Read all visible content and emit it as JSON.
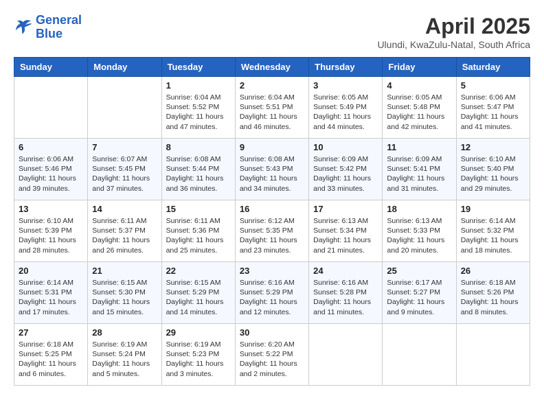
{
  "header": {
    "logo_line1": "General",
    "logo_line2": "Blue",
    "month_title": "April 2025",
    "location": "Ulundi, KwaZulu-Natal, South Africa"
  },
  "days_of_week": [
    "Sunday",
    "Monday",
    "Tuesday",
    "Wednesday",
    "Thursday",
    "Friday",
    "Saturday"
  ],
  "weeks": [
    [
      {
        "day": "",
        "info": ""
      },
      {
        "day": "",
        "info": ""
      },
      {
        "day": "1",
        "info": "Sunrise: 6:04 AM\nSunset: 5:52 PM\nDaylight: 11 hours and 47 minutes."
      },
      {
        "day": "2",
        "info": "Sunrise: 6:04 AM\nSunset: 5:51 PM\nDaylight: 11 hours and 46 minutes."
      },
      {
        "day": "3",
        "info": "Sunrise: 6:05 AM\nSunset: 5:49 PM\nDaylight: 11 hours and 44 minutes."
      },
      {
        "day": "4",
        "info": "Sunrise: 6:05 AM\nSunset: 5:48 PM\nDaylight: 11 hours and 42 minutes."
      },
      {
        "day": "5",
        "info": "Sunrise: 6:06 AM\nSunset: 5:47 PM\nDaylight: 11 hours and 41 minutes."
      }
    ],
    [
      {
        "day": "6",
        "info": "Sunrise: 6:06 AM\nSunset: 5:46 PM\nDaylight: 11 hours and 39 minutes."
      },
      {
        "day": "7",
        "info": "Sunrise: 6:07 AM\nSunset: 5:45 PM\nDaylight: 11 hours and 37 minutes."
      },
      {
        "day": "8",
        "info": "Sunrise: 6:08 AM\nSunset: 5:44 PM\nDaylight: 11 hours and 36 minutes."
      },
      {
        "day": "9",
        "info": "Sunrise: 6:08 AM\nSunset: 5:43 PM\nDaylight: 11 hours and 34 minutes."
      },
      {
        "day": "10",
        "info": "Sunrise: 6:09 AM\nSunset: 5:42 PM\nDaylight: 11 hours and 33 minutes."
      },
      {
        "day": "11",
        "info": "Sunrise: 6:09 AM\nSunset: 5:41 PM\nDaylight: 11 hours and 31 minutes."
      },
      {
        "day": "12",
        "info": "Sunrise: 6:10 AM\nSunset: 5:40 PM\nDaylight: 11 hours and 29 minutes."
      }
    ],
    [
      {
        "day": "13",
        "info": "Sunrise: 6:10 AM\nSunset: 5:39 PM\nDaylight: 11 hours and 28 minutes."
      },
      {
        "day": "14",
        "info": "Sunrise: 6:11 AM\nSunset: 5:37 PM\nDaylight: 11 hours and 26 minutes."
      },
      {
        "day": "15",
        "info": "Sunrise: 6:11 AM\nSunset: 5:36 PM\nDaylight: 11 hours and 25 minutes."
      },
      {
        "day": "16",
        "info": "Sunrise: 6:12 AM\nSunset: 5:35 PM\nDaylight: 11 hours and 23 minutes."
      },
      {
        "day": "17",
        "info": "Sunrise: 6:13 AM\nSunset: 5:34 PM\nDaylight: 11 hours and 21 minutes."
      },
      {
        "day": "18",
        "info": "Sunrise: 6:13 AM\nSunset: 5:33 PM\nDaylight: 11 hours and 20 minutes."
      },
      {
        "day": "19",
        "info": "Sunrise: 6:14 AM\nSunset: 5:32 PM\nDaylight: 11 hours and 18 minutes."
      }
    ],
    [
      {
        "day": "20",
        "info": "Sunrise: 6:14 AM\nSunset: 5:31 PM\nDaylight: 11 hours and 17 minutes."
      },
      {
        "day": "21",
        "info": "Sunrise: 6:15 AM\nSunset: 5:30 PM\nDaylight: 11 hours and 15 minutes."
      },
      {
        "day": "22",
        "info": "Sunrise: 6:15 AM\nSunset: 5:29 PM\nDaylight: 11 hours and 14 minutes."
      },
      {
        "day": "23",
        "info": "Sunrise: 6:16 AM\nSunset: 5:29 PM\nDaylight: 11 hours and 12 minutes."
      },
      {
        "day": "24",
        "info": "Sunrise: 6:16 AM\nSunset: 5:28 PM\nDaylight: 11 hours and 11 minutes."
      },
      {
        "day": "25",
        "info": "Sunrise: 6:17 AM\nSunset: 5:27 PM\nDaylight: 11 hours and 9 minutes."
      },
      {
        "day": "26",
        "info": "Sunrise: 6:18 AM\nSunset: 5:26 PM\nDaylight: 11 hours and 8 minutes."
      }
    ],
    [
      {
        "day": "27",
        "info": "Sunrise: 6:18 AM\nSunset: 5:25 PM\nDaylight: 11 hours and 6 minutes."
      },
      {
        "day": "28",
        "info": "Sunrise: 6:19 AM\nSunset: 5:24 PM\nDaylight: 11 hours and 5 minutes."
      },
      {
        "day": "29",
        "info": "Sunrise: 6:19 AM\nSunset: 5:23 PM\nDaylight: 11 hours and 3 minutes."
      },
      {
        "day": "30",
        "info": "Sunrise: 6:20 AM\nSunset: 5:22 PM\nDaylight: 11 hours and 2 minutes."
      },
      {
        "day": "",
        "info": ""
      },
      {
        "day": "",
        "info": ""
      },
      {
        "day": "",
        "info": ""
      }
    ]
  ]
}
